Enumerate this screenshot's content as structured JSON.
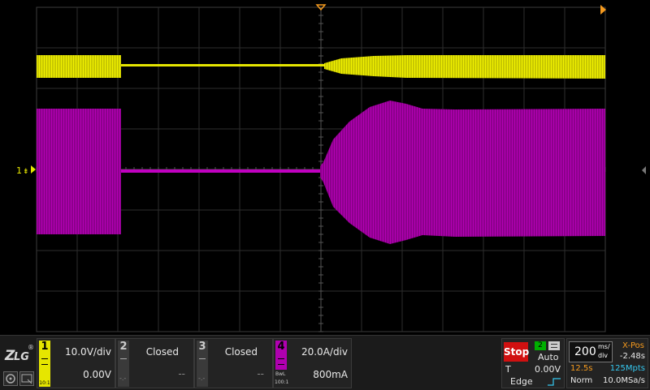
{
  "colors": {
    "ch1": "#e6e600",
    "ch4": "#b000b0",
    "accent_orange": "#f59a1e",
    "stop_red": "#d01010",
    "grid": "#3c3c3c",
    "cyan": "#35c8f0"
  },
  "scope": {
    "ch1_marker": "1"
  },
  "channels": [
    {
      "num": "1",
      "scale": "10.0V/div",
      "offset": "0.00V",
      "probe": "10:1",
      "state": "on"
    },
    {
      "num": "2",
      "status": "Closed",
      "dash1": "--",
      "dash2": "--"
    },
    {
      "num": "3",
      "status": "Closed",
      "dash1": "--",
      "dash2": "--"
    },
    {
      "num": "4",
      "scale": "20.0A/div",
      "offset": "800mA",
      "probe_top": "BwL",
      "probe": "100:1",
      "state": "on"
    }
  ],
  "trigger": {
    "run_state": "Stop",
    "source": "2",
    "mode": "Auto",
    "t_label": "T",
    "level": "0.00V",
    "type": "Edge"
  },
  "timebase": {
    "value": "200",
    "unit_top": "ms/",
    "unit_bottom": "div",
    "xpos_label": "X-Pos",
    "xpos_value": "-2.48s",
    "duration": "12.5s",
    "points": "125Mpts",
    "acq_mode": "Norm",
    "sample_rate": "10.0MSa/s"
  },
  "logo": "ZLG"
}
